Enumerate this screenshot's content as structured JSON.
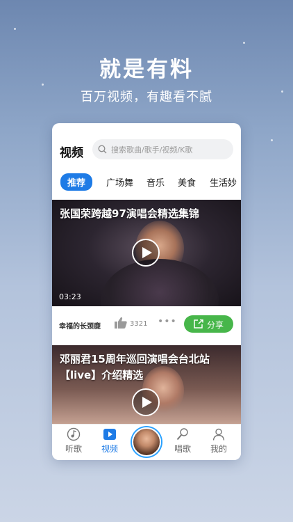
{
  "promo": {
    "headline": "就是有料",
    "subline": "百万视频，有趣看不腻"
  },
  "header": {
    "title": "视频",
    "search_placeholder": "搜索歌曲/歌手/视频/K歌"
  },
  "tabs": [
    {
      "label": "推荐",
      "active": true
    },
    {
      "label": "广场舞"
    },
    {
      "label": "音乐"
    },
    {
      "label": "美食"
    },
    {
      "label": "生活妙"
    }
  ],
  "videos": [
    {
      "title": "张国荣跨越97演唱会精选集锦",
      "duration": "03:23",
      "author": "幸福的长颈鹿",
      "likes": "3321",
      "share_label": "分享"
    },
    {
      "title": "邓丽君15周年巡回演唱会台北站【live】介绍精选"
    }
  ],
  "bottom_nav": [
    {
      "label": "听歌",
      "icon": "music-note-icon"
    },
    {
      "label": "视频",
      "icon": "video-icon",
      "active": true
    },
    {
      "label": "",
      "icon": "avatar"
    },
    {
      "label": "唱歌",
      "icon": "microphone-icon"
    },
    {
      "label": "我的",
      "icon": "user-icon"
    }
  ],
  "colors": {
    "accent": "#1e7be6",
    "share_green": "#47b64a",
    "avatar_ring": "#2aa1ff"
  }
}
